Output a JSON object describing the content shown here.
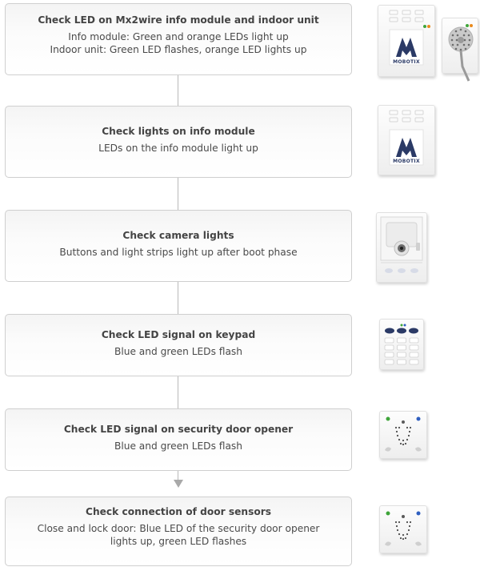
{
  "steps": [
    {
      "title": "Check LED on Mx2wire info module and indoor unit",
      "desc": [
        "Info module: Green and orange LEDs light up",
        "Indoor unit: Green LED flashes, orange LED lights up"
      ]
    },
    {
      "title": "Check lights on info module",
      "desc": [
        "LEDs on the info module light up"
      ]
    },
    {
      "title": "Check camera lights",
      "desc": [
        "Buttons and light strips light up after boot phase"
      ]
    },
    {
      "title": "Check LED signal on keypad",
      "desc": [
        "Blue and green LEDs flash"
      ]
    },
    {
      "title": "Check LED signal on security door opener",
      "desc": [
        "Blue and green LEDs flash"
      ]
    },
    {
      "title": "Check connection of door sensors",
      "desc": [
        "Close and lock door: Blue LED of the security door opener",
        "lights up, green LED flashes"
      ]
    }
  ],
  "logo": "MOBOTIX",
  "colors": {
    "box_border": "#cfcfcf",
    "connector": "#b9b9b9",
    "mobotix_blue": "#2b3a66",
    "led_green": "#3fa53a",
    "led_orange": "#e98a1d",
    "led_blue": "#2f5fc0"
  }
}
